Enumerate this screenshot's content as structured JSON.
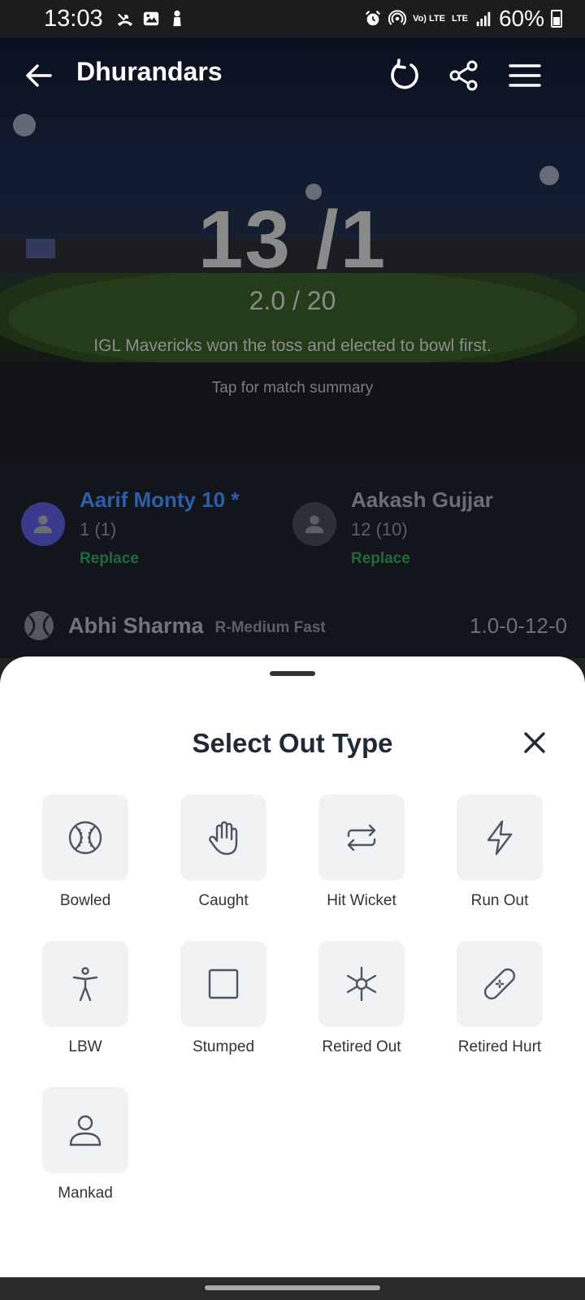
{
  "status_bar": {
    "time": "13:03",
    "net_top": "Vo) LTE",
    "net_mid": "LTE",
    "battery": "60%"
  },
  "app_bar": {
    "title": "Dhurandars"
  },
  "scoreboard": {
    "score": "13 /1",
    "overs": "2.0 / 20",
    "toss": "IGL Mavericks won the toss and elected to bowl first.",
    "tap_hint": "Tap for match summary"
  },
  "batters": [
    {
      "name": "Aarif Monty 10 *",
      "score": "1 (1)",
      "replace": "Replace",
      "color": "#2c5fa8",
      "avatar_color": "#3a3a8c"
    },
    {
      "name": "Aakash Gujjar",
      "score": "12 (10)",
      "replace": "Replace",
      "color": "#6b6e74",
      "avatar_color": "#2c2f36"
    }
  ],
  "bowler": {
    "name": "Abhi Sharma",
    "style": "R-Medium Fast",
    "figures": "1.0-0-12-0"
  },
  "sheet": {
    "title": "Select Out Type",
    "options": [
      {
        "label": "Bowled",
        "icon": "cricket-ball-icon"
      },
      {
        "label": "Caught",
        "icon": "hand-icon"
      },
      {
        "label": "Hit Wicket",
        "icon": "repeat-arrows-icon"
      },
      {
        "label": "Run Out",
        "icon": "lightning-icon"
      },
      {
        "label": "LBW",
        "icon": "person-standing-icon"
      },
      {
        "label": "Stumped",
        "icon": "square-icon"
      },
      {
        "label": "Retired Out",
        "icon": "asterisk-icon"
      },
      {
        "label": "Retired Hurt",
        "icon": "bandage-icon"
      },
      {
        "label": "Mankad",
        "icon": "user-icon"
      }
    ]
  }
}
